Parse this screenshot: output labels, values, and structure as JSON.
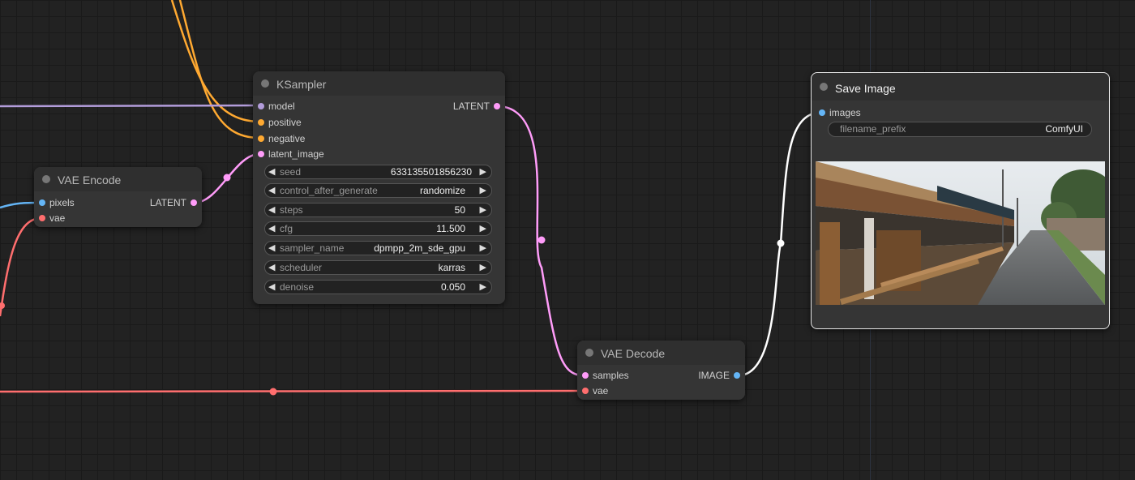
{
  "nodes": {
    "ksampler": {
      "title": "KSampler",
      "inputs": [
        "model",
        "positive",
        "negative",
        "latent_image"
      ],
      "output": "LATENT",
      "widgets": [
        {
          "name": "seed",
          "value": "633135501856230"
        },
        {
          "name": "control_after_generate",
          "value": "randomize"
        },
        {
          "name": "steps",
          "value": "50"
        },
        {
          "name": "cfg",
          "value": "11.500"
        },
        {
          "name": "sampler_name",
          "value": "dpmpp_2m_sde_gpu"
        },
        {
          "name": "scheduler",
          "value": "karras"
        },
        {
          "name": "denoise",
          "value": "0.050"
        }
      ]
    },
    "vae_encode": {
      "title": "VAE Encode",
      "inputs": [
        "pixels",
        "vae"
      ],
      "output": "LATENT"
    },
    "vae_decode": {
      "title": "VAE Decode",
      "inputs": [
        "samples",
        "vae"
      ],
      "output": "IMAGE"
    },
    "save_image": {
      "title": "Save Image",
      "inputs": [
        "images"
      ],
      "widget": {
        "name": "filename_prefix",
        "value": "ComfyUI"
      }
    }
  },
  "colors": {
    "model": "#b39ddb",
    "conditioning": "#ffa931",
    "latent": "#ff9cf9",
    "vae": "#ff6e6e",
    "image": "#64b5f6",
    "image_link": "#ffffff",
    "node_bg": "#353535",
    "canvas_bg": "#222222"
  },
  "icons": {
    "arrow_left": "◀",
    "arrow_right": "▶"
  }
}
